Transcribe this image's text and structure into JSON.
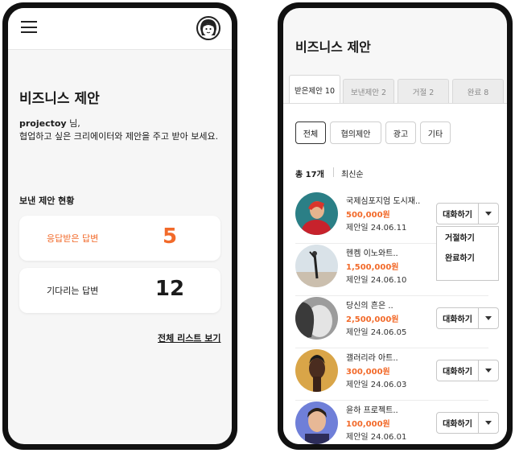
{
  "left_screen": {
    "title": "비즈니스 제안",
    "greeting_user": "projectoy",
    "greeting_suffix": " 님,",
    "greeting_line2": "협업하고 싶은 크리에이터와 제안을 주고 받아 보세요.",
    "section_title": "보낸 제안 현황",
    "stats": [
      {
        "label": "응답받은 답변",
        "value": "5",
        "color": "#f26a2a"
      },
      {
        "label": "기다리는 답변",
        "value": "12",
        "color": "#1b1b1b"
      }
    ],
    "view_all": "전체 리스트 보기"
  },
  "right_screen": {
    "title": "비즈니스 제안",
    "tabs": [
      {
        "label": "받은제안 10",
        "active": true
      },
      {
        "label": "보낸제안 2",
        "active": false
      },
      {
        "label": "거절 2",
        "active": false
      },
      {
        "label": "완료 8",
        "active": false
      }
    ],
    "filters": [
      {
        "label": "전체",
        "active": true
      },
      {
        "label": "협의제안",
        "active": false
      },
      {
        "label": "광고",
        "active": false
      },
      {
        "label": "기타",
        "active": false
      }
    ],
    "total": "총 17개",
    "sort": "최신순",
    "chat_label": "대화하기",
    "dropdown_items": [
      "거절하기",
      "완료하기"
    ],
    "rows": [
      {
        "name": "국제심포지엄 도시재..",
        "price": "500,000원",
        "date": "제안일 24.06.11",
        "show_button": true
      },
      {
        "name": "헨켐 이노와트..",
        "price": "1,500,000원",
        "date": "제안일 24.06.10",
        "show_button": false
      },
      {
        "name": "당신의 흔은 ..",
        "price": "2,500,000원",
        "date": "제안일 24.06.05",
        "show_button": true
      },
      {
        "name": "갤러리라 아트..",
        "price": "300,000원",
        "date": "제안일 24.06.03",
        "show_button": true
      },
      {
        "name": "윤하 프로젝트..",
        "price": "100,000원",
        "date": "제안일 24.06.01",
        "show_button": true
      }
    ],
    "colors": {
      "accent": "#f26a2a"
    }
  }
}
